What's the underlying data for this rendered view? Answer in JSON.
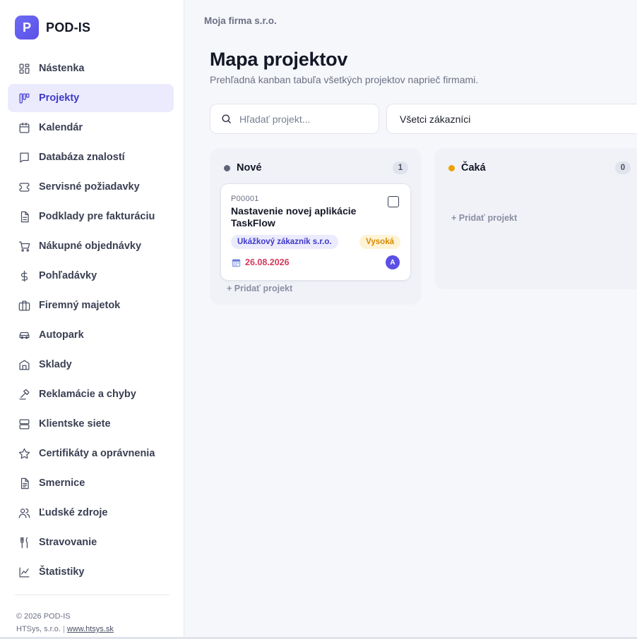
{
  "brand": {
    "logo_letter": "P",
    "name": "POD-IS",
    "accent": "#5b4fe6"
  },
  "sidebar": {
    "items": [
      {
        "label": "Nástenka",
        "icon": "dashboard-icon",
        "active": false
      },
      {
        "label": "Projekty",
        "icon": "kanban-icon",
        "active": true
      },
      {
        "label": "Kalendár",
        "icon": "calendar-icon",
        "active": false
      },
      {
        "label": "Databáza znalostí",
        "icon": "book-icon",
        "active": false
      },
      {
        "label": "Servisné požiadavky",
        "icon": "ticket-icon",
        "active": false
      },
      {
        "label": "Podklady pre fakturáciu",
        "icon": "document-icon",
        "active": false
      },
      {
        "label": "Nákupné objednávky",
        "icon": "cart-icon",
        "active": false
      },
      {
        "label": "Pohľadávky",
        "icon": "dollar-icon",
        "active": false
      },
      {
        "label": "Firemný majetok",
        "icon": "briefcase-icon",
        "active": false
      },
      {
        "label": "Autopark",
        "icon": "car-icon",
        "active": false
      },
      {
        "label": "Sklady",
        "icon": "warehouse-icon",
        "active": false
      },
      {
        "label": "Reklamácie a chyby",
        "icon": "hammer-icon",
        "active": false
      },
      {
        "label": "Klientske siete",
        "icon": "server-icon",
        "active": false
      },
      {
        "label": "Certifikáty a oprávnenia",
        "icon": "star-icon",
        "active": false
      },
      {
        "label": "Smernice",
        "icon": "file-text-icon",
        "active": false
      },
      {
        "label": "Ľudské zdroje",
        "icon": "users-icon",
        "active": false
      },
      {
        "label": "Stravovanie",
        "icon": "utensils-icon",
        "active": false
      },
      {
        "label": "Štatistiky",
        "icon": "chart-icon",
        "active": false
      }
    ],
    "footer": {
      "copyright": "© 2026 POD-IS",
      "company": "HTSys, s.r.o.",
      "separator": "|",
      "link": "www.htsys.sk"
    }
  },
  "header": {
    "company": "Moja firma s.r.o.",
    "title": "Mapa projektov",
    "subtitle": "Prehľadná kanban tabuľa všetkých projektov naprieč firmami."
  },
  "filters": {
    "search_placeholder": "Hľadať projekt...",
    "customer_select": "Všetci zákazníci"
  },
  "columns": [
    {
      "title": "Nové",
      "count": "1",
      "color": "#5f6478",
      "add_label": "+ Pridať projekt",
      "cards": [
        {
          "code": "P00001",
          "title": "Nastavenie novej aplikácie TaskFlow",
          "customer": "Ukážkový zákazník s.r.o.",
          "priority": "Vysoká",
          "date": "26.08.2026",
          "assignee": "A"
        }
      ]
    },
    {
      "title": "Čaká",
      "count": "0",
      "color": "#f0a000",
      "add_label": "+ Pridať projekt",
      "cards": []
    }
  ]
}
